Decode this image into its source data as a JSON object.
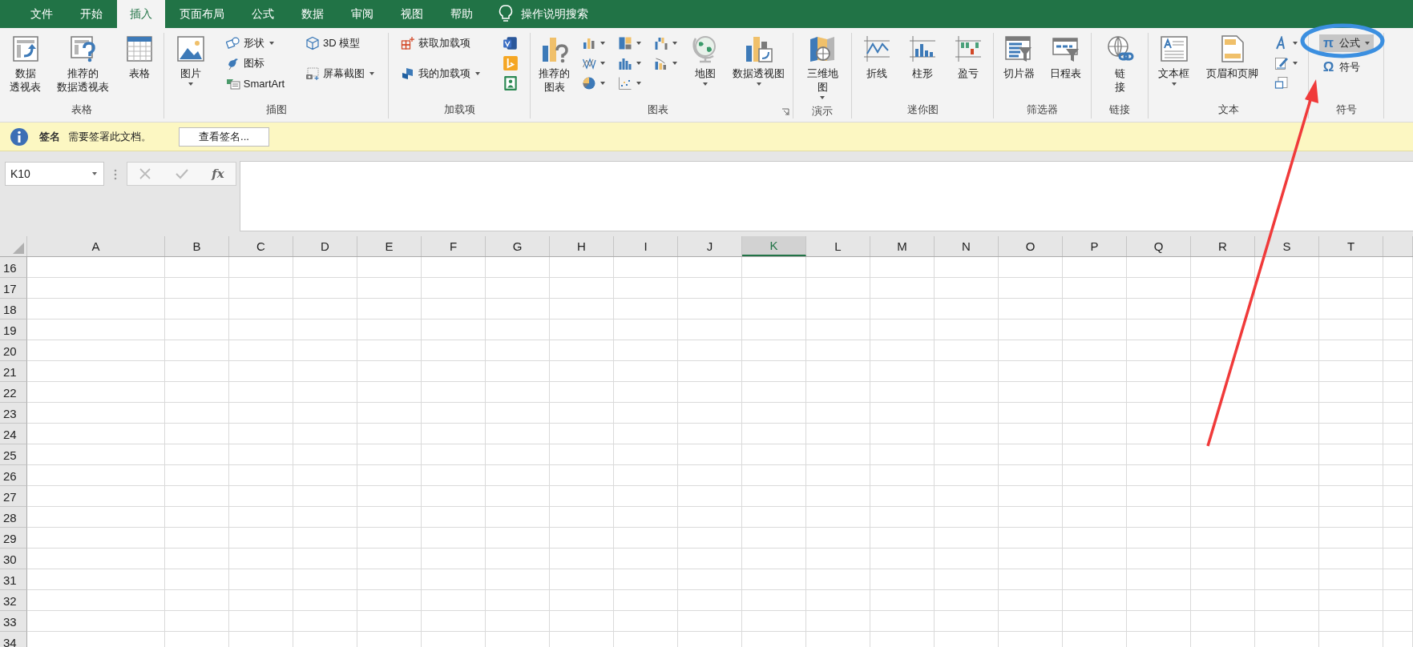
{
  "tabs": [
    {
      "label": "文件",
      "selected": false
    },
    {
      "label": "开始",
      "selected": false
    },
    {
      "label": "插入",
      "selected": true
    },
    {
      "label": "页面布局",
      "selected": false
    },
    {
      "label": "公式",
      "selected": false
    },
    {
      "label": "数据",
      "selected": false
    },
    {
      "label": "审阅",
      "selected": false
    },
    {
      "label": "视图",
      "selected": false
    },
    {
      "label": "帮助",
      "selected": false
    }
  ],
  "search": {
    "label": "操作说明搜索"
  },
  "ribbon_groups": [
    {
      "label": "表格",
      "launcher": false,
      "columns": [
        [
          {
            "kind": "large",
            "lines": [
              "数据",
              "透视表"
            ],
            "dropdown": false
          }
        ],
        [
          {
            "kind": "large",
            "lines": [
              "推荐的",
              "数据透视表"
            ],
            "dropdown": false
          }
        ],
        [
          {
            "kind": "large",
            "lines": [
              "表格"
            ],
            "dropdown": false
          }
        ]
      ]
    },
    {
      "label": "插图",
      "launcher": false,
      "columns": [
        [
          {
            "kind": "large",
            "lines": [
              "图片"
            ],
            "dropdown": true
          }
        ],
        [
          {
            "kind": "small",
            "label": "形状",
            "dropdown": true
          },
          {
            "kind": "small",
            "label": "图标",
            "dropdown": false
          },
          {
            "kind": "small",
            "label": "SmartArt",
            "dropdown": false
          }
        ],
        [
          {
            "kind": "small",
            "label": "3D 模型",
            "dropdown": false
          },
          {
            "kind": "small",
            "label": "屏幕截图",
            "dropdown": true
          }
        ]
      ]
    },
    {
      "label": "加载项",
      "launcher": false,
      "columns": [
        [
          {
            "kind": "small",
            "label": "获取加载项",
            "dropdown": false
          },
          {
            "kind": "small",
            "label": "我的加载项",
            "dropdown": true
          }
        ],
        [
          {
            "kind": "icon",
            "dropdown": false
          },
          {
            "kind": "icon",
            "dropdown": false
          },
          {
            "kind": "icon",
            "dropdown": false
          }
        ]
      ]
    },
    {
      "label": "图表",
      "launcher": true,
      "columns": [
        [
          {
            "kind": "large",
            "lines": [
              "推荐的",
              "图表"
            ],
            "dropdown": false
          }
        ],
        [
          {
            "kind": "icon",
            "dropdown": true
          },
          {
            "kind": "icon",
            "dropdown": true
          },
          {
            "kind": "icon",
            "dropdown": true
          }
        ],
        [
          {
            "kind": "icon",
            "dropdown": true
          },
          {
            "kind": "icon",
            "dropdown": true
          },
          {
            "kind": "icon",
            "dropdown": true
          }
        ],
        [
          {
            "kind": "icon",
            "dropdown": true
          },
          {
            "kind": "icon",
            "dropdown": true
          }
        ],
        [
          {
            "kind": "large",
            "lines": [
              "地图"
            ],
            "dropdown": true
          }
        ],
        [
          {
            "kind": "large",
            "lines": [
              "数据透视图"
            ],
            "dropdown": true
          }
        ]
      ]
    },
    {
      "label": "演示",
      "launcher": false,
      "columns": [
        [
          {
            "kind": "large",
            "lines": [
              "三维地",
              "图"
            ],
            "dropdown": true
          }
        ]
      ]
    },
    {
      "label": "迷你图",
      "launcher": false,
      "columns": [
        [
          {
            "kind": "large",
            "lines": [
              "折线"
            ],
            "dropdown": false
          }
        ],
        [
          {
            "kind": "large",
            "lines": [
              "柱形"
            ],
            "dropdown": false
          }
        ],
        [
          {
            "kind": "large",
            "lines": [
              "盈亏"
            ],
            "dropdown": false
          }
        ]
      ]
    },
    {
      "label": "筛选器",
      "launcher": false,
      "columns": [
        [
          {
            "kind": "large",
            "lines": [
              "切片器"
            ],
            "dropdown": false
          }
        ],
        [
          {
            "kind": "large",
            "lines": [
              "日程表"
            ],
            "dropdown": false
          }
        ]
      ]
    },
    {
      "label": "链接",
      "launcher": false,
      "columns": [
        [
          {
            "kind": "large",
            "lines": [
              "链",
              "接"
            ],
            "dropdown": false
          }
        ]
      ]
    },
    {
      "label": "文本",
      "launcher": false,
      "columns": [
        [
          {
            "kind": "large",
            "lines": [
              "文本框"
            ],
            "dropdown": true
          }
        ],
        [
          {
            "kind": "large",
            "lines": [
              "页眉和页脚"
            ],
            "dropdown": false
          }
        ],
        [
          {
            "kind": "icon",
            "dropdown": true
          },
          {
            "kind": "icon",
            "dropdown": true
          },
          {
            "kind": "icon",
            "dropdown": false
          }
        ]
      ]
    },
    {
      "label": "符号",
      "launcher": false,
      "columns": [
        [
          {
            "kind": "glyph",
            "glyph": "π",
            "label": "公式",
            "dropdown": true,
            "highlighted": true
          },
          {
            "kind": "glyph",
            "glyph": "Ω",
            "label": "符号",
            "dropdown": false,
            "highlighted": false
          }
        ]
      ]
    }
  ],
  "message_bar": {
    "title": "签名",
    "text": "需要签署此文档。",
    "button": "查看签名..."
  },
  "formula_bar": {
    "name_box": "K10",
    "function_label": "fx"
  },
  "columns": [
    {
      "label": "A",
      "selected": false
    },
    {
      "label": "B",
      "selected": false
    },
    {
      "label": "C",
      "selected": false
    },
    {
      "label": "D",
      "selected": false
    },
    {
      "label": "E",
      "selected": false
    },
    {
      "label": "F",
      "selected": false
    },
    {
      "label": "G",
      "selected": false
    },
    {
      "label": "H",
      "selected": false
    },
    {
      "label": "I",
      "selected": false
    },
    {
      "label": "J",
      "selected": false
    },
    {
      "label": "K",
      "selected": true
    },
    {
      "label": "L",
      "selected": false
    },
    {
      "label": "M",
      "selected": false
    },
    {
      "label": "N",
      "selected": false
    },
    {
      "label": "O",
      "selected": false
    },
    {
      "label": "P",
      "selected": false
    },
    {
      "label": "Q",
      "selected": false
    },
    {
      "label": "R",
      "selected": false
    },
    {
      "label": "S",
      "selected": false
    },
    {
      "label": "T",
      "selected": false
    }
  ],
  "rows": [
    "16",
    "17",
    "18",
    "19",
    "20",
    "21",
    "22",
    "23",
    "24",
    "25",
    "26",
    "27",
    "28",
    "29",
    "30",
    "31",
    "32",
    "33",
    "34"
  ]
}
